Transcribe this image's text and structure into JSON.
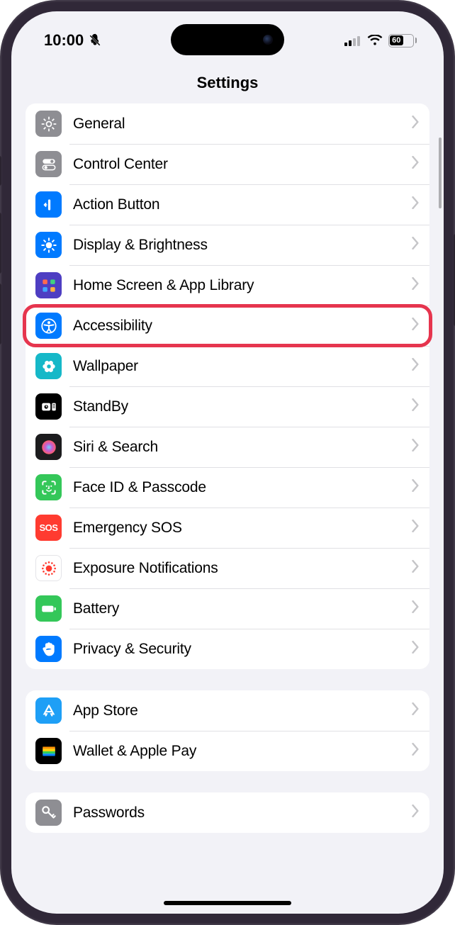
{
  "status": {
    "time": "10:00",
    "battery_pct": "60"
  },
  "title": "Settings",
  "groups": [
    {
      "items": [
        {
          "key": "general",
          "label": "General",
          "icon": "gear",
          "bg": "#8e8e93"
        },
        {
          "key": "control-center",
          "label": "Control Center",
          "icon": "switch",
          "bg": "#8e8e93"
        },
        {
          "key": "action-button",
          "label": "Action Button",
          "icon": "action",
          "bg": "#007aff"
        },
        {
          "key": "display",
          "label": "Display & Brightness",
          "icon": "brightness",
          "bg": "#007aff"
        },
        {
          "key": "home-screen",
          "label": "Home Screen & App Library",
          "icon": "grid",
          "bg": "#4e3ec2"
        },
        {
          "key": "accessibility",
          "label": "Accessibility",
          "icon": "accessibility",
          "bg": "#007aff",
          "highlighted": true
        },
        {
          "key": "wallpaper",
          "label": "Wallpaper",
          "icon": "flower",
          "bg": "#16b8c8"
        },
        {
          "key": "standby",
          "label": "StandBy",
          "icon": "standby",
          "bg": "#000000"
        },
        {
          "key": "siri",
          "label": "Siri & Search",
          "icon": "siri",
          "bg": "#1c1c1e"
        },
        {
          "key": "faceid",
          "label": "Face ID & Passcode",
          "icon": "faceid",
          "bg": "#34c759"
        },
        {
          "key": "sos",
          "label": "Emergency SOS",
          "icon": "sos",
          "bg": "#ff3b30"
        },
        {
          "key": "exposure",
          "label": "Exposure Notifications",
          "icon": "exposure",
          "bg": "#ffffff"
        },
        {
          "key": "battery",
          "label": "Battery",
          "icon": "battery",
          "bg": "#34c759"
        },
        {
          "key": "privacy",
          "label": "Privacy & Security",
          "icon": "hand",
          "bg": "#007aff"
        }
      ]
    },
    {
      "items": [
        {
          "key": "app-store",
          "label": "App Store",
          "icon": "appstore",
          "bg": "#1e9ff6"
        },
        {
          "key": "wallet",
          "label": "Wallet & Apple Pay",
          "icon": "wallet",
          "bg": "#000000"
        }
      ]
    },
    {
      "items": [
        {
          "key": "passwords",
          "label": "Passwords",
          "icon": "key",
          "bg": "#8e8e93"
        }
      ]
    }
  ]
}
